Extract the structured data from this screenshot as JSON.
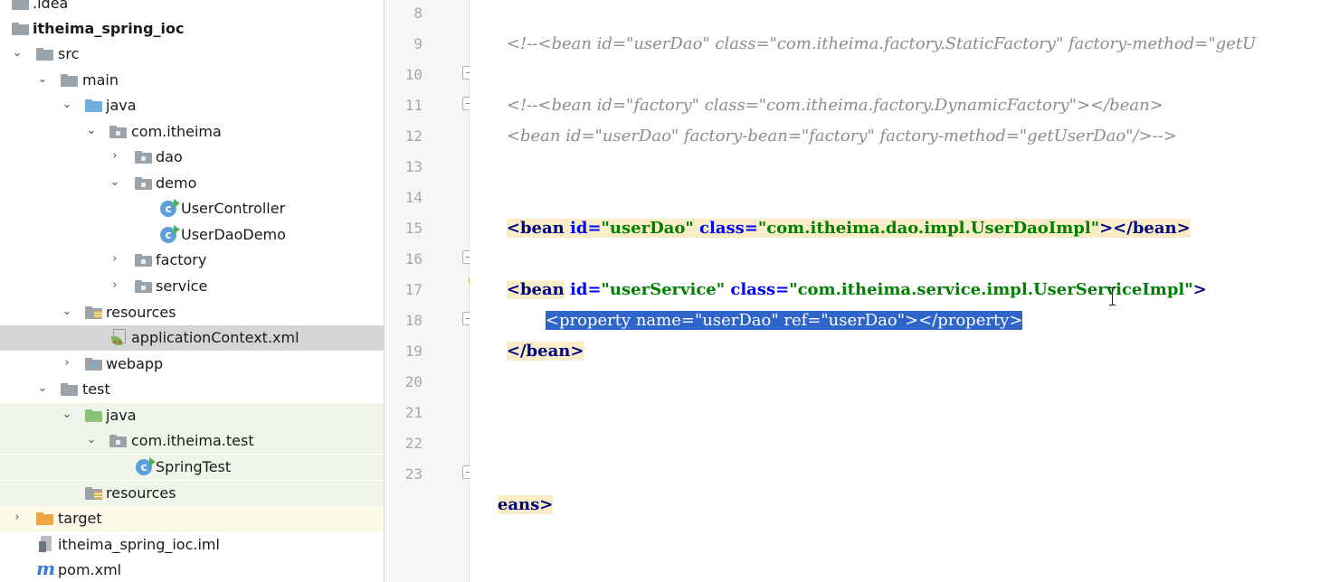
{
  "project_tree": {
    "items": [
      {
        "label": ".idea",
        "icon": "folder-icon"
      },
      {
        "label": "itheima_spring_ioc",
        "icon": "module-folder-icon"
      },
      {
        "label": "src",
        "icon": "folder-icon"
      },
      {
        "label": "main",
        "icon": "folder-icon"
      },
      {
        "label": "java",
        "icon": "source-folder-icon"
      },
      {
        "label": "com.itheima",
        "icon": "package-icon"
      },
      {
        "label": "dao",
        "icon": "package-icon"
      },
      {
        "label": "demo",
        "icon": "package-icon"
      },
      {
        "label": "UserController",
        "icon": "runnable-class-icon"
      },
      {
        "label": "UserDaoDemo",
        "icon": "runnable-class-icon"
      },
      {
        "label": "factory",
        "icon": "package-icon"
      },
      {
        "label": "service",
        "icon": "package-icon"
      },
      {
        "label": "resources",
        "icon": "resources-folder-icon"
      },
      {
        "label": "applicationContext.xml",
        "icon": "spring-xml-file-icon"
      },
      {
        "label": "webapp",
        "icon": "web-folder-icon"
      },
      {
        "label": "test",
        "icon": "folder-icon"
      },
      {
        "label": "java",
        "icon": "test-source-folder-icon"
      },
      {
        "label": "com.itheima.test",
        "icon": "package-icon"
      },
      {
        "label": "SpringTest",
        "icon": "runnable-class-icon"
      },
      {
        "label": "resources",
        "icon": "test-resources-folder-icon"
      },
      {
        "label": "target",
        "icon": "excluded-folder-icon"
      },
      {
        "label": "itheima_spring_ioc.iml",
        "icon": "iml-file-icon"
      },
      {
        "label": "pom.xml",
        "icon": "maven-icon"
      }
    ]
  },
  "editor": {
    "line_numbers": [
      "8",
      "9",
      "10",
      "11",
      "12",
      "13",
      "14",
      "15",
      "16",
      "17",
      "18",
      "19",
      "20",
      "21",
      "22",
      "23"
    ],
    "line8": "<!--<bean id=\"userDao\" class=\"com.itheima.factory.StaticFactory\" factory-method=\"getU",
    "line10": "<!--<bean id=\"factory\" class=\"com.itheima.factory.DynamicFactory\"></bean>",
    "line11": "<bean id=\"userDao\" factory-bean=\"factory\" factory-method=\"getUserDao\"/>-->",
    "line14": {
      "open": "<bean",
      "a1": " id=",
      "v1": "\"userDao\"",
      "a2": " class=",
      "v2": "\"com.itheima.dao.impl.UserDaoImpl\"",
      "close": "></bean>"
    },
    "line16": {
      "open": "<bean",
      "a1": " id=",
      "v1": "\"userService\"",
      "a2": " class=",
      "v2": "\"com.itheima.service.impl.UserServiceImpl\"",
      "close": ">"
    },
    "line17": "<property name=\"userDao\" ref=\"userDao\"></property>",
    "line18": "</bean>",
    "line23": "eans>"
  },
  "colors": {
    "selection": "#2f65ca",
    "tag": "#000080",
    "attribute": "#0000ff",
    "value": "#008000",
    "comment": "#8c8c8c",
    "highlight": "#f9edc8"
  }
}
